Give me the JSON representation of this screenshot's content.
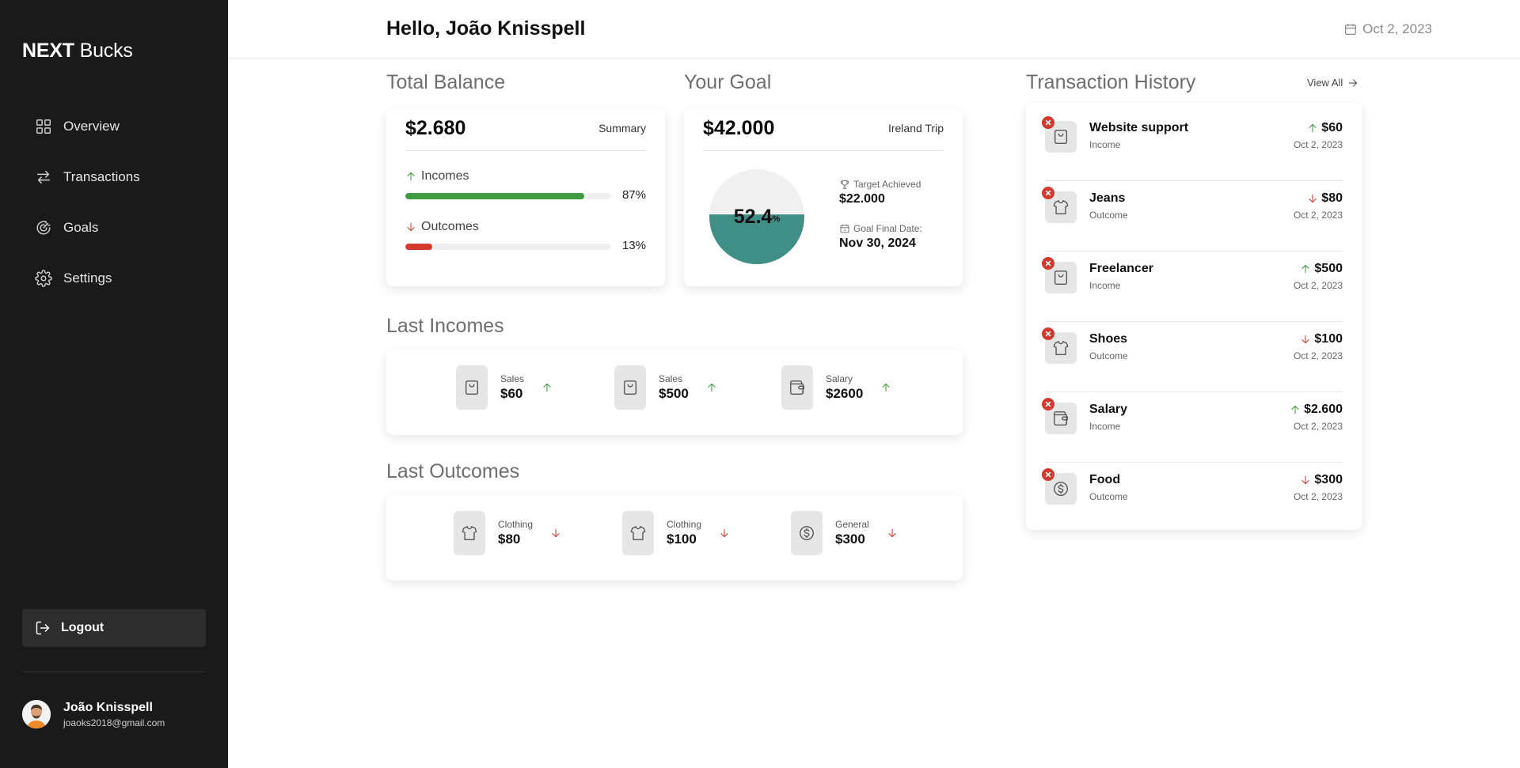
{
  "app": {
    "logo_bold": "NEXT",
    "logo_light": "Bucks"
  },
  "sidebar": {
    "items": [
      {
        "label": "Overview",
        "icon": "grid-icon"
      },
      {
        "label": "Transactions",
        "icon": "arrows-icon"
      },
      {
        "label": "Goals",
        "icon": "target-icon"
      },
      {
        "label": "Settings",
        "icon": "gear-icon"
      }
    ],
    "logout_label": "Logout",
    "user": {
      "name": "João Knisspell",
      "email": "joaoks2018@gmail.com"
    }
  },
  "header": {
    "greeting": "Hello, João Knisspell",
    "date": "Oct 2, 2023"
  },
  "balance": {
    "title": "Total Balance",
    "amount": "$2.680",
    "tag": "Summary",
    "incomes_label": "Incomes",
    "incomes_pct": "87%",
    "incomes_fraction": 0.87,
    "outcomes_label": "Outcomes",
    "outcomes_pct": "13%",
    "outcomes_fraction": 0.13
  },
  "goal": {
    "title": "Your Goal",
    "amount": "$42.000",
    "tag": "Ireland Trip",
    "percent": "52.4",
    "percent_sign": "%",
    "fraction": 0.524,
    "target_label": "Target Achieved",
    "target_value": "$22.000",
    "date_label": "Goal Final Date:",
    "date_value": "Nov 30, 2024"
  },
  "last_incomes": {
    "title": "Last Incomes",
    "items": [
      {
        "category": "Sales",
        "value": "$60",
        "icon": "bag-icon"
      },
      {
        "category": "Sales",
        "value": "$500",
        "icon": "bag-icon"
      },
      {
        "category": "Salary",
        "value": "$2600",
        "icon": "wallet-icon"
      }
    ]
  },
  "last_outcomes": {
    "title": "Last Outcomes",
    "items": [
      {
        "category": "Clothing",
        "value": "$80",
        "icon": "shirt-icon"
      },
      {
        "category": "Clothing",
        "value": "$100",
        "icon": "shirt-icon"
      },
      {
        "category": "General",
        "value": "$300",
        "icon": "dollar-icon"
      }
    ]
  },
  "transactions": {
    "title": "Transaction History",
    "view_all": "View All",
    "items": [
      {
        "name": "Website support",
        "type": "Income",
        "amount": "$60",
        "date": "Oct 2, 2023",
        "icon": "bag-icon"
      },
      {
        "name": "Jeans",
        "type": "Outcome",
        "amount": "$80",
        "date": "Oct 2, 2023",
        "icon": "shirt-icon"
      },
      {
        "name": "Freelancer",
        "type": "Income",
        "amount": "$500",
        "date": "Oct 2, 2023",
        "icon": "bag-icon"
      },
      {
        "name": "Shoes",
        "type": "Outcome",
        "amount": "$100",
        "date": "Oct 2, 2023",
        "icon": "shirt-icon"
      },
      {
        "name": "Salary",
        "type": "Income",
        "amount": "$2.600",
        "date": "Oct 2, 2023",
        "icon": "wallet-icon"
      },
      {
        "name": "Food",
        "type": "Outcome",
        "amount": "$300",
        "date": "Oct 2, 2023",
        "icon": "dollar-icon"
      }
    ]
  },
  "colors": {
    "sidebar_bg": "#1a1a1a",
    "income_green": "#3d9c3f",
    "outcome_red": "#d23a2f",
    "goal_teal": "#3f8f86",
    "goal_light": "#f0f0f0"
  }
}
